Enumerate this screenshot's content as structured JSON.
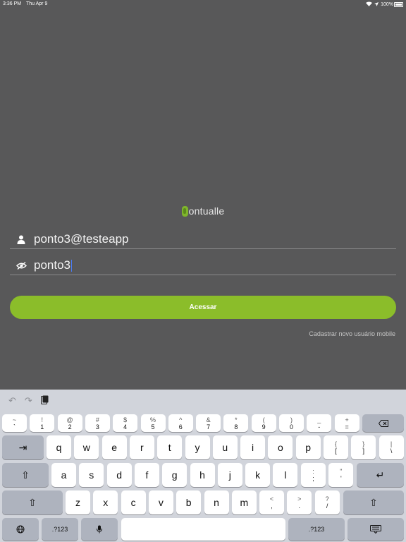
{
  "status": {
    "time": "3:36 PM",
    "date": "Thu Apr 9",
    "battery": "100%"
  },
  "app": {
    "logo_text": "ontualle",
    "brand_color": "#8bbd2a"
  },
  "login": {
    "email_value": "ponto3@testeapp",
    "password_value": "ponto3",
    "submit_label": "Acessar",
    "register_link": "Cadastrar novo usuário mobile"
  },
  "keyboard": {
    "row1": [
      [
        "~",
        "`"
      ],
      [
        "!",
        "1"
      ],
      [
        "@",
        "2"
      ],
      [
        "#",
        "3"
      ],
      [
        "$",
        "4"
      ],
      [
        "%",
        "5"
      ],
      [
        "^",
        "6"
      ],
      [
        "&",
        "7"
      ],
      [
        "*",
        "8"
      ],
      [
        "(",
        "9"
      ],
      [
        ")",
        "0"
      ],
      [
        "_",
        "-"
      ],
      [
        "+",
        "="
      ]
    ],
    "row2": [
      "q",
      "w",
      "e",
      "r",
      "t",
      "y",
      "u",
      "i",
      "o",
      "p"
    ],
    "row2_extra": [
      [
        "{",
        "["
      ],
      [
        "}",
        "]"
      ],
      [
        "|",
        "\\"
      ]
    ],
    "row3": [
      "a",
      "s",
      "d",
      "f",
      "g",
      "h",
      "j",
      "k",
      "l"
    ],
    "row3_extra": [
      [
        ":",
        ";"
      ],
      [
        "\"",
        "'"
      ]
    ],
    "row4": [
      "z",
      "x",
      "c",
      "v",
      "b",
      "n",
      "m"
    ],
    "row4_extra": [
      [
        "<",
        ","
      ],
      [
        ">",
        "."
      ],
      [
        "?",
        "/"
      ]
    ],
    "num_label": ".?123"
  }
}
